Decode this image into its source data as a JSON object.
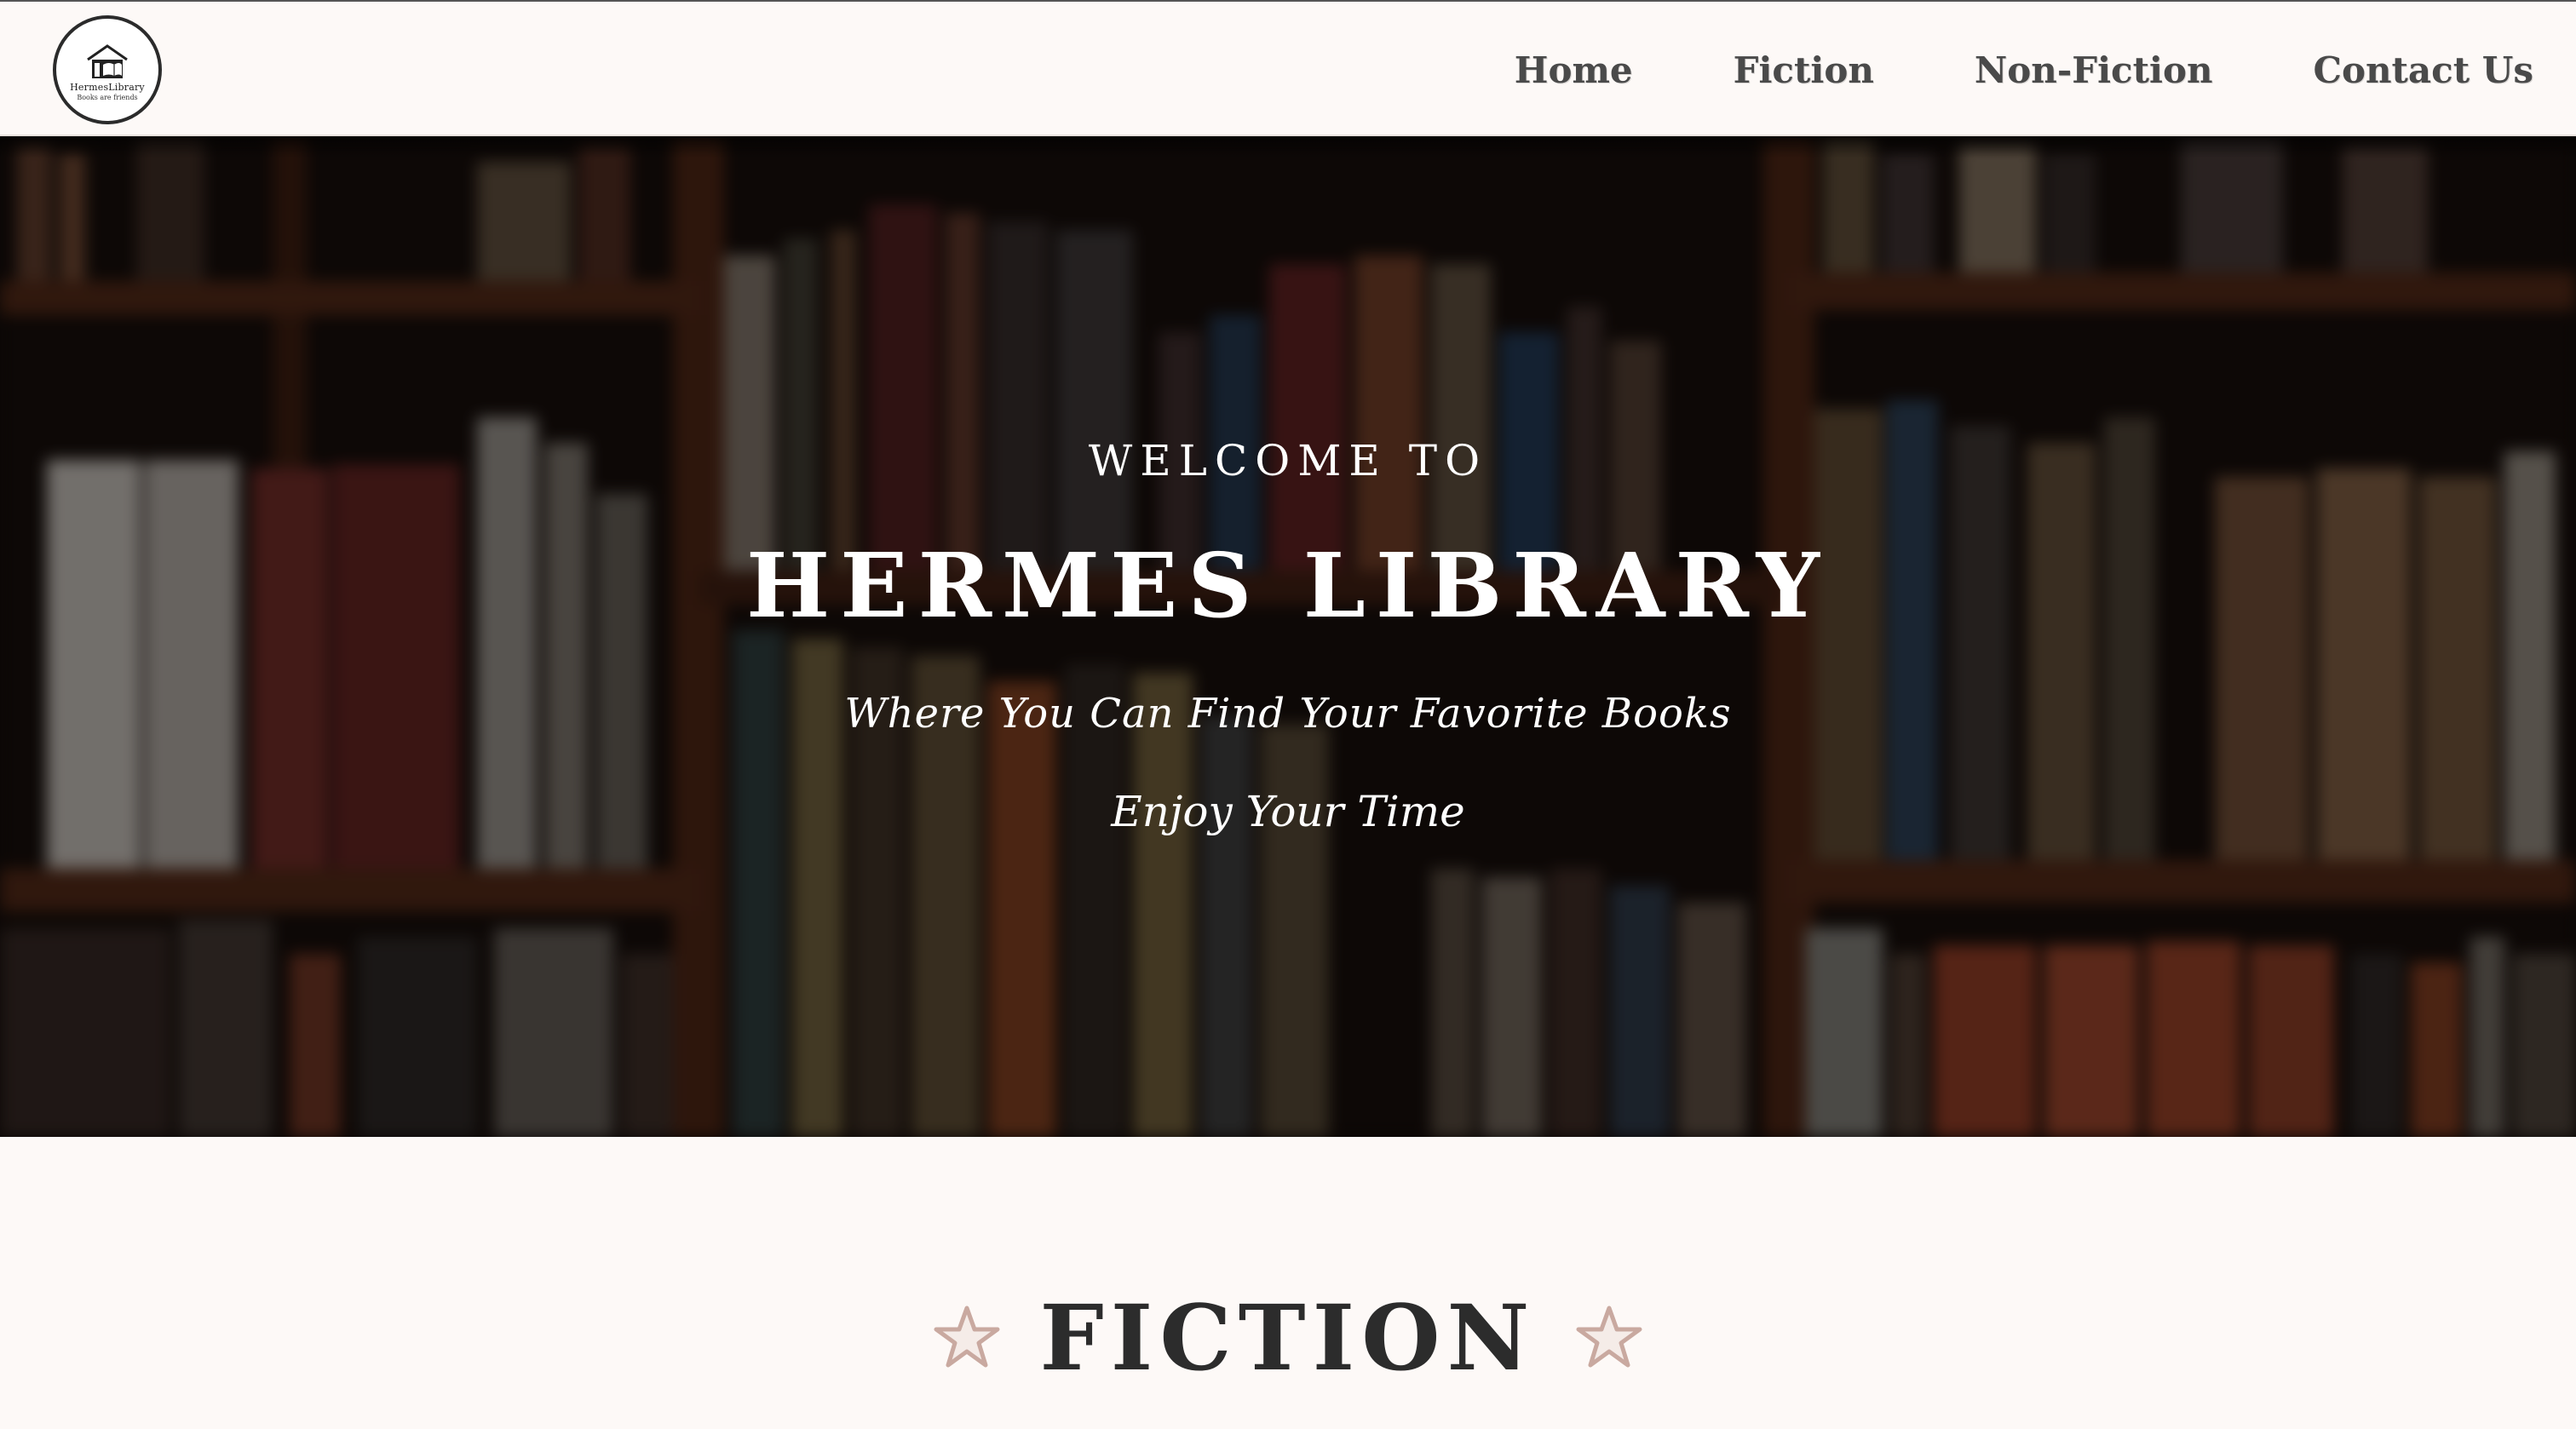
{
  "header": {
    "logo": {
      "name": "HermesLibrary",
      "tagline": "Books are friends"
    },
    "nav": [
      "Home",
      "Fiction",
      "Non-Fiction",
      "Contact Us"
    ]
  },
  "hero": {
    "welcome": "WELCOME TO",
    "title": "HERMES LIBRARY",
    "subtitle": "Where You Can Find Your Favorite Books",
    "tagline": "Enjoy Your Time"
  },
  "section": {
    "title": "FICTION",
    "decoration_icon": "star-outline-icon"
  },
  "colors": {
    "page_background": "#fdf9f7",
    "nav_text": "#4a4a4a",
    "hero_text": "#ffffff",
    "heading_text": "#2c2c2c",
    "star_accent": "#c9a9a0"
  }
}
